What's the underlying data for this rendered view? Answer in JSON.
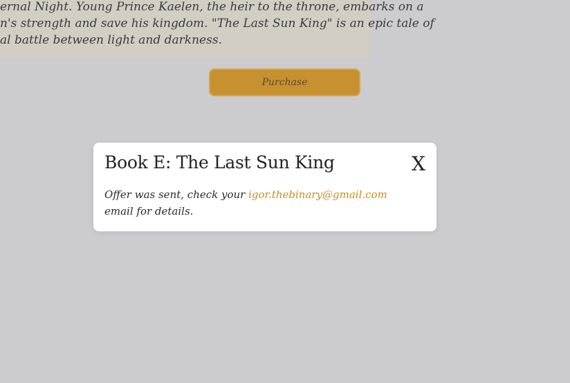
{
  "description": {
    "lines": [
      "ernal Night. Young Prince Kaelen, the heir to the throne, embarks on a",
      "n's strength and save his kingdom. \"The Last Sun King\" is an epic tale of",
      "al battle between light and darkness."
    ]
  },
  "purchase": {
    "label": "Purchase"
  },
  "dialog": {
    "title": "Book E: The Last Sun King",
    "close_label": "X",
    "message_prefix": "Offer was sent, check your ",
    "email": "igor.thebinary@gmail.com",
    "message_suffix": " email for details."
  },
  "colors": {
    "background": "#cccbcd",
    "card": "#d3cec4",
    "button": "#c8912f",
    "accent_link": "#d08a1a"
  }
}
